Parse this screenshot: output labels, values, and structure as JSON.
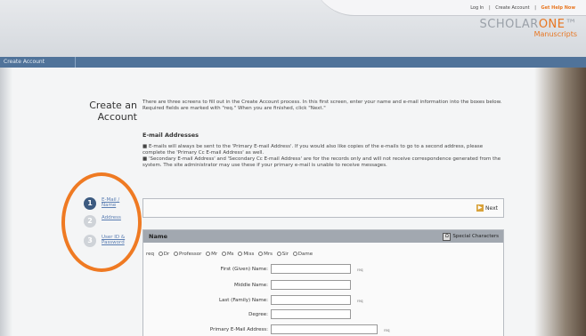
{
  "header": {
    "links": [
      "Log In",
      "Create Account",
      "Get Help Now"
    ],
    "separator": "|",
    "logo_main": "SCHOLAR",
    "logo_accent": "ONE",
    "logo_tm": "™",
    "logo_sub": "Manuscripts"
  },
  "breadcrumb": "Create Account",
  "page": {
    "title": "Create an Account",
    "intro": "There are three screens to fill out in the Create Account process. In this first screen, enter your name and e-mail information into the boxes below. Required fields are marked with \"req.\" When you are finished, click \"Next.\"",
    "section_heading": "E-mail Addresses",
    "bullets": [
      "■ E-mails will always be sent to the 'Primary E-mail Address'. If you would also like copies of the e-mails to go to a second address, please complete the 'Primary Cc E-mail Address' as well.",
      "■ 'Secondary E-mail Address' and 'Secondary Cc E-mail Address' are for the records only and will not receive correspondence generated from the system. The site administrator may use these if your primary e-mail is unable to receive messages."
    ]
  },
  "steps": [
    {
      "num": "1",
      "label": "E-Mail / Name",
      "active": true
    },
    {
      "num": "2",
      "label": "Address",
      "active": false
    },
    {
      "num": "3",
      "label": "User ID & Password",
      "active": false
    }
  ],
  "next_label": "Next",
  "name_panel": {
    "heading": "Name",
    "special_chars": "Special Characters",
    "req": "req",
    "titles": [
      "Dr",
      "Professor",
      "Mr",
      "Ms",
      "Miss",
      "Mrs",
      "Sir",
      "Dame"
    ],
    "fields": [
      {
        "label": "First (Given) Name:",
        "value": "",
        "req": true
      },
      {
        "label": "Middle Name:",
        "value": "",
        "req": false
      },
      {
        "label": "Last (Family) Name:",
        "value": "",
        "req": true
      },
      {
        "label": "Degree:",
        "value": "",
        "req": false
      },
      {
        "label": "Primary E-Mail Address:",
        "value": "",
        "req": true
      }
    ]
  },
  "colors": {
    "accent": "#e87722",
    "bar": "#50739a",
    "annotation": "#ef7a23"
  }
}
